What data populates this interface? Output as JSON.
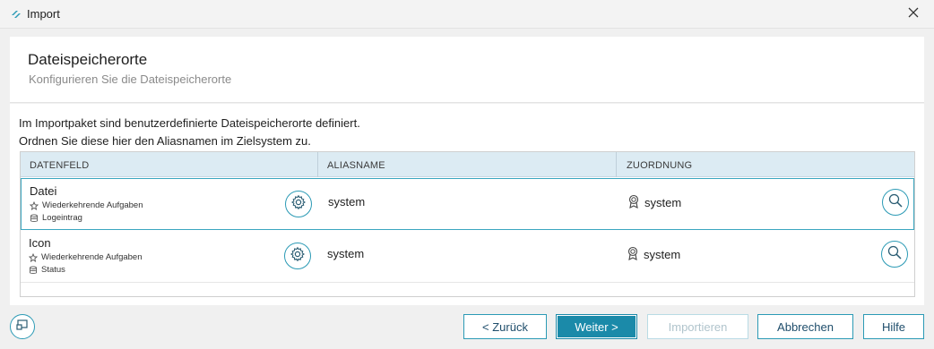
{
  "window": {
    "title": "Import"
  },
  "header": {
    "title": "Dateispeicherorte",
    "subtitle": "Konfigurieren Sie die Dateispeicherorte"
  },
  "intro": {
    "line1": "Im Importpaket sind benutzerdefinierte Dateispeicherorte definiert.",
    "line2": "Ordnen Sie diese hier den Aliasnamen im Zielsystem zu."
  },
  "grid": {
    "columns": [
      "DATENFELD",
      "ALIASNAME",
      "ZUORDNUNG"
    ],
    "rows": [
      {
        "name": "Datei",
        "task": "Wiederkehrende Aufgaben",
        "table": "Logeintrag",
        "alias": "system",
        "assignment": "system",
        "selected": true
      },
      {
        "name": "Icon",
        "task": "Wiederkehrende Aufgaben",
        "table": "Status",
        "alias": "system",
        "assignment": "system",
        "selected": false
      }
    ]
  },
  "buttons": {
    "back": "< Zurück",
    "next": "Weiter >",
    "import": "Importieren",
    "cancel": "Abbrechen",
    "help": "Hilfe"
  },
  "icons": {
    "app": "app-logo-icon",
    "close": "close-icon",
    "gear": "gear-icon",
    "task": "recurring-task-icon",
    "table": "database-icon",
    "assignment": "award-badge-icon",
    "search": "search-icon",
    "footer": "window-icon"
  },
  "colors": {
    "accent": "#2b9ab5",
    "primary_button": "#1b8aa9",
    "grid_header": "#dcebf3"
  }
}
